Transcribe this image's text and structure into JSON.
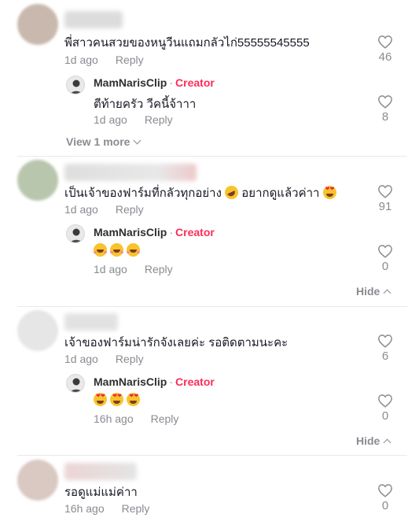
{
  "colors": {
    "creator": "#fe2c55",
    "meta": "#8a8b91",
    "text": "#161823"
  },
  "comments": [
    {
      "text": "พี่สาวคนสวยของหนูวีนแถมกลัวไก่55555545555",
      "time": "1d ago",
      "reply_label": "Reply",
      "likes": "46",
      "reply": {
        "author": "MamNarisClip",
        "separator": "·",
        "badge": "Creator",
        "text": "ตีท้ายครัว วีคนี้จ้าาา",
        "time": "1d ago",
        "reply_label": "Reply",
        "likes": "8"
      },
      "toggle_label": "View 1 more"
    },
    {
      "text": "เป็นเจ้าของฟาร์มที่กลัวทุกอย่าง",
      "text_after": "อยากดูแล้วค่าา",
      "time": "1d ago",
      "reply_label": "Reply",
      "likes": "91",
      "reply": {
        "author": "MamNarisClip",
        "separator": "·",
        "badge": "Creator",
        "emojis": [
          "smiling-face-with-hearts-emoji",
          "smiling-face-with-hearts-emoji",
          "smiling-face-with-hearts-emoji"
        ],
        "time": "1d ago",
        "reply_label": "Reply",
        "likes": "0"
      },
      "toggle_label": "Hide"
    },
    {
      "text": "เจ้าของฟาร์มน่ารักจังเลยค่ะ รอติดตามนะคะ",
      "time": "1d ago",
      "reply_label": "Reply",
      "likes": "6",
      "reply": {
        "author": "MamNarisClip",
        "separator": "·",
        "badge": "Creator",
        "emojis": [
          "heart-eyes-emoji",
          "heart-eyes-emoji",
          "heart-eyes-emoji"
        ],
        "time": "16h ago",
        "reply_label": "Reply",
        "likes": "0"
      },
      "toggle_label": "Hide"
    },
    {
      "text": "รอดูแม่แม่ค่าา",
      "time": "16h ago",
      "reply_label": "Reply",
      "likes": "0"
    }
  ]
}
